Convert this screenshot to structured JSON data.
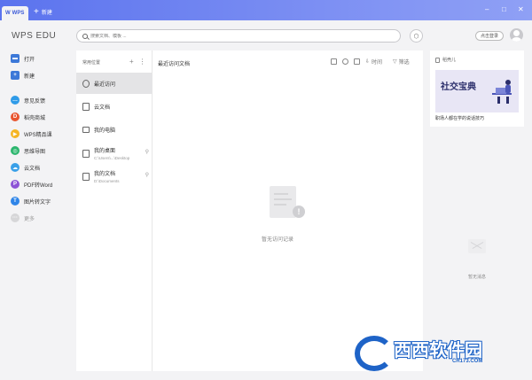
{
  "titlebar": {
    "active_tab": "WPS",
    "new_tab": "新建"
  },
  "app": {
    "title": "WPS EDU"
  },
  "search": {
    "placeholder": "搜索文档、模板 ..."
  },
  "header": {
    "login_label": "点击登录"
  },
  "sidebar": {
    "items": [
      {
        "label": "打开",
        "icon": "folder-icon",
        "color": "#3c78d8"
      },
      {
        "label": "新建",
        "icon": "new-file-icon",
        "color": "#3c78d8"
      },
      {
        "label": "意见反馈",
        "icon": "feedback-icon",
        "color": "#2f9be8"
      },
      {
        "label": "稻壳商城",
        "icon": "docer-icon",
        "color": "#e8552f"
      },
      {
        "label": "WPS精品课",
        "icon": "course-icon",
        "color": "#f5b523"
      },
      {
        "label": "思维导图",
        "icon": "mindmap-icon",
        "color": "#2cb66e"
      },
      {
        "label": "云文档",
        "icon": "cloud-doc-icon",
        "color": "#3aa0e8"
      },
      {
        "label": "PDF转Word",
        "icon": "pdf-icon",
        "color": "#8c52d6"
      },
      {
        "label": "图片转文字",
        "icon": "ocr-icon",
        "color": "#2f85e8"
      },
      {
        "label": "更多",
        "icon": "more-icon",
        "color": "#c6c6c8"
      }
    ]
  },
  "locations": {
    "header": "常用位置",
    "items": [
      {
        "label": "最近访问",
        "sub": ""
      },
      {
        "label": "云文档",
        "sub": ""
      },
      {
        "label": "我的电脑",
        "sub": ""
      },
      {
        "label": "我的桌面",
        "sub": "C:\\Users\\...\\Desktop"
      },
      {
        "label": "我的文档",
        "sub": "D:\\Documents"
      }
    ]
  },
  "recent": {
    "title": "最近访问文档",
    "time_label": "时间",
    "filter_label": "筛选",
    "empty_text": "暂无访问记录"
  },
  "promo": {
    "title": "稻壳儿",
    "banner_title": "社交宝典",
    "caption": "职场人都在学的说话技巧"
  },
  "messages": {
    "empty_text": "暂无消息"
  },
  "watermark": {
    "main": "西西软件园",
    "sub": "CR173.COM"
  }
}
